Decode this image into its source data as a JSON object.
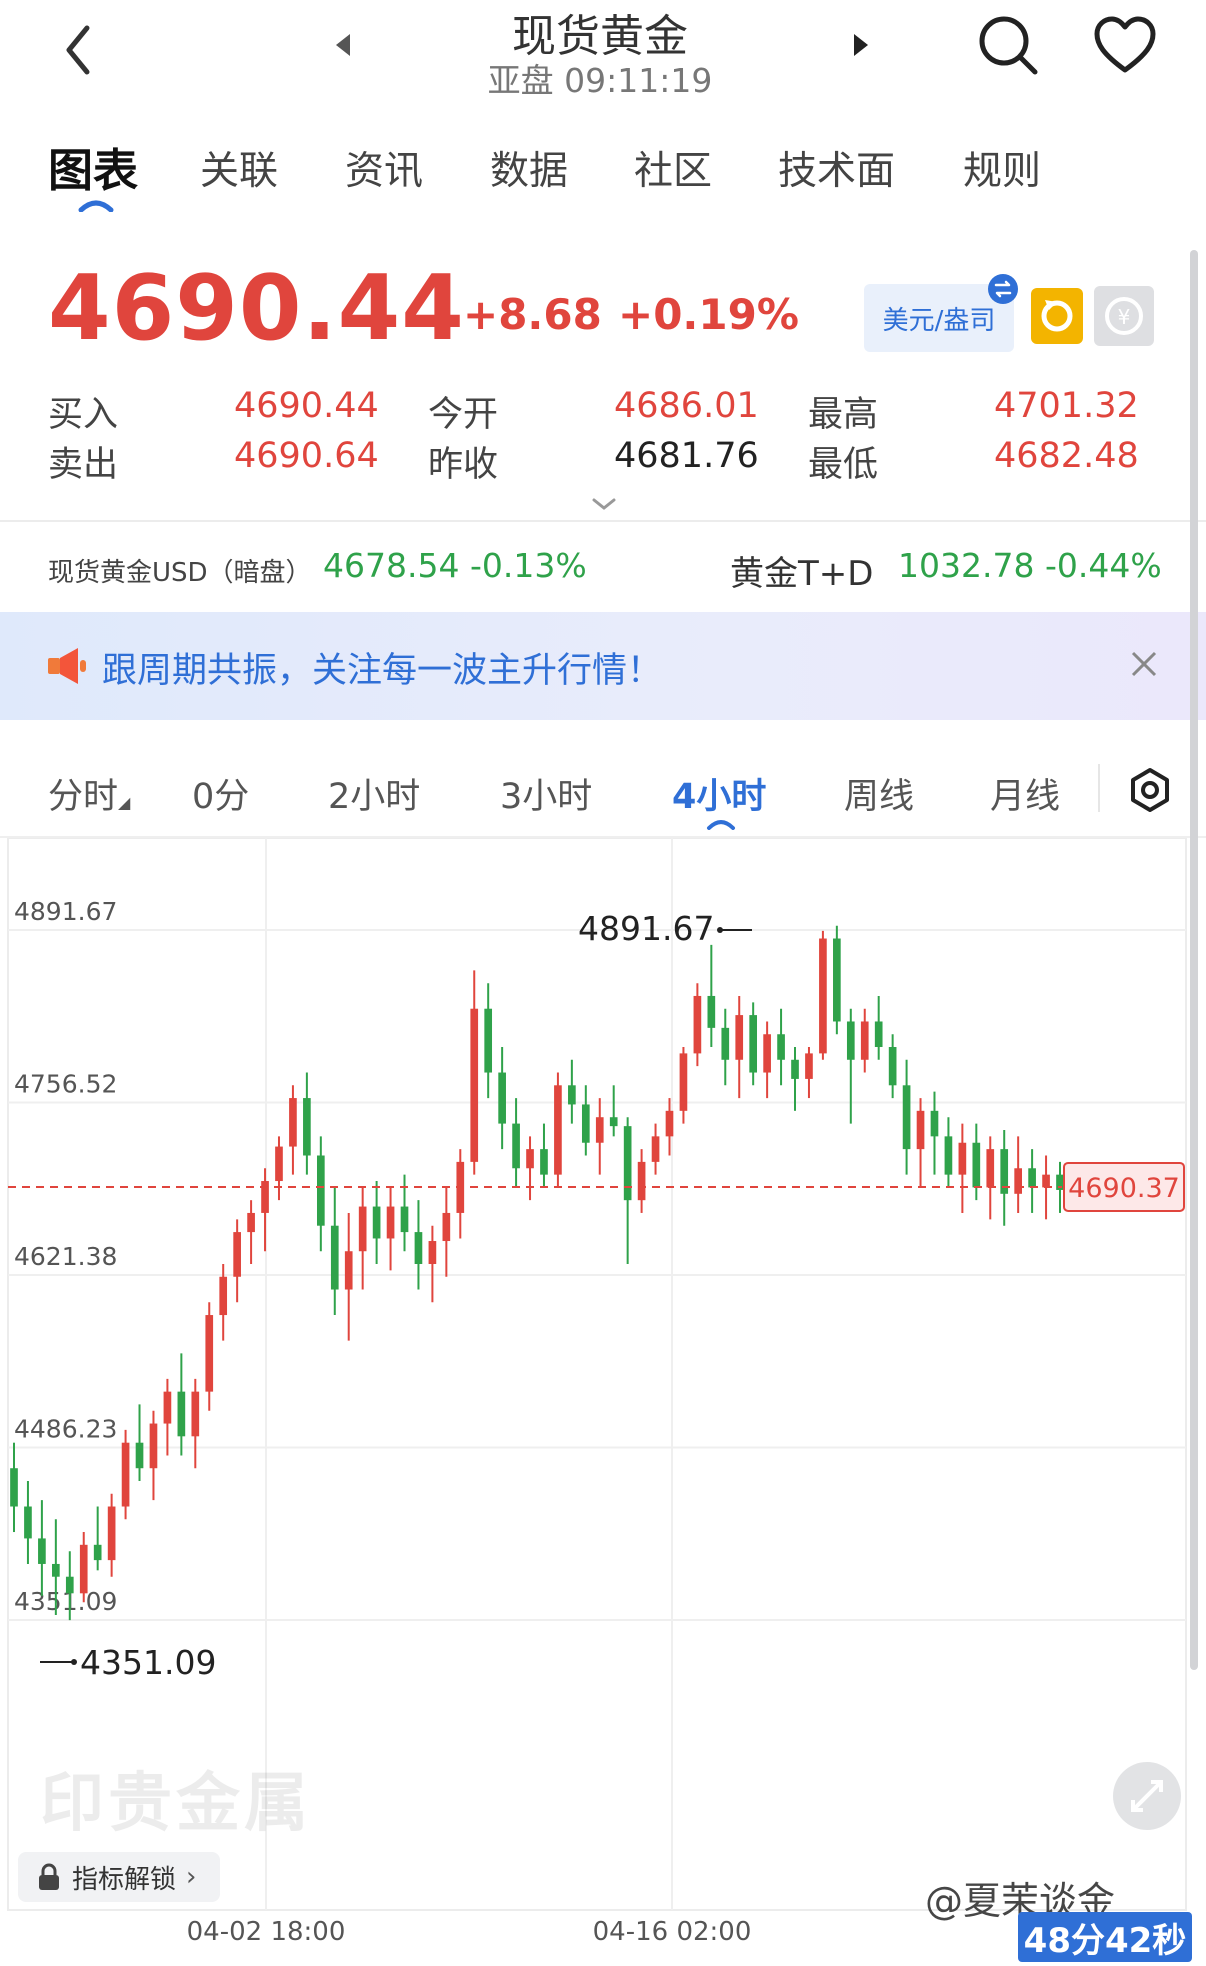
{
  "header": {
    "title": "现货黄金",
    "subtitle": "亚盘 09:11:19"
  },
  "tabs": [
    {
      "label": "图表",
      "active": true
    },
    {
      "label": "关联"
    },
    {
      "label": "资讯"
    },
    {
      "label": "数据"
    },
    {
      "label": "社区"
    },
    {
      "label": "技术面"
    },
    {
      "label": "规则"
    }
  ],
  "quote": {
    "price": "4690.44",
    "change": "+8.68",
    "change_pct": "+0.19%",
    "unit_label": "美元/盎司",
    "bid_label": "买入",
    "bid": "4690.44",
    "ask_label": "卖出",
    "ask": "4690.64",
    "open_label": "今开",
    "open": "4686.01",
    "prev_close_label": "昨收",
    "prev_close": "4681.76",
    "high_label": "最高",
    "high": "4701.32",
    "low_label": "最低",
    "low": "4682.48"
  },
  "related": {
    "left_name": "现货黄金USD（暗盘）",
    "left_value": "4678.54  -0.13%",
    "right_name": "黄金T+D",
    "right_value": "1032.78  -0.44%"
  },
  "banner": {
    "text": "跟周期共振，关注每一波主升行情！"
  },
  "periods": [
    {
      "label": "分时"
    },
    {
      "label": "0分"
    },
    {
      "label": "2小时"
    },
    {
      "label": "3小时"
    },
    {
      "label": "4小时",
      "active": true
    },
    {
      "label": "周线"
    },
    {
      "label": "月线"
    }
  ],
  "chart_data": {
    "type": "candlestick",
    "y_ticks": [
      "4891.67",
      "4756.52",
      "4621.38",
      "4486.23",
      "4351.09"
    ],
    "x_ticks": [
      "04-02 18:00",
      "04-16 02:00"
    ],
    "max_label": "4891.67",
    "min_label": "4351.09",
    "current_price_label": "4690.37",
    "ylim": [
      4351.09,
      4891.67
    ],
    "up_color": "#e0453d",
    "down_color": "#2fa24a",
    "ohlc": [
      [
        4470,
        4490,
        4420,
        4440
      ],
      [
        4440,
        4460,
        4395,
        4415
      ],
      [
        4415,
        4445,
        4370,
        4395
      ],
      [
        4395,
        4430,
        4355,
        4385
      ],
      [
        4385,
        4405,
        4351,
        4372
      ],
      [
        4372,
        4420,
        4365,
        4410
      ],
      [
        4410,
        4440,
        4390,
        4398
      ],
      [
        4398,
        4450,
        4385,
        4440
      ],
      [
        4440,
        4500,
        4430,
        4490
      ],
      [
        4490,
        4520,
        4460,
        4470
      ],
      [
        4470,
        4515,
        4445,
        4505
      ],
      [
        4505,
        4540,
        4480,
        4530
      ],
      [
        4530,
        4560,
        4480,
        4495
      ],
      [
        4495,
        4540,
        4470,
        4530
      ],
      [
        4530,
        4600,
        4515,
        4590
      ],
      [
        4590,
        4630,
        4570,
        4620
      ],
      [
        4620,
        4665,
        4600,
        4655
      ],
      [
        4655,
        4680,
        4630,
        4670
      ],
      [
        4670,
        4705,
        4640,
        4695
      ],
      [
        4695,
        4730,
        4680,
        4722
      ],
      [
        4722,
        4770,
        4700,
        4760
      ],
      [
        4760,
        4780,
        4700,
        4715
      ],
      [
        4715,
        4730,
        4640,
        4660
      ],
      [
        4660,
        4690,
        4590,
        4610
      ],
      [
        4610,
        4670,
        4570,
        4640
      ],
      [
        4640,
        4690,
        4610,
        4675
      ],
      [
        4675,
        4695,
        4630,
        4650
      ],
      [
        4650,
        4690,
        4625,
        4675
      ],
      [
        4675,
        4700,
        4640,
        4655
      ],
      [
        4655,
        4680,
        4610,
        4630
      ],
      [
        4630,
        4660,
        4600,
        4648
      ],
      [
        4648,
        4690,
        4620,
        4670
      ],
      [
        4670,
        4720,
        4650,
        4710
      ],
      [
        4710,
        4860,
        4700,
        4830
      ],
      [
        4830,
        4850,
        4760,
        4780
      ],
      [
        4780,
        4800,
        4720,
        4740
      ],
      [
        4740,
        4760,
        4690,
        4705
      ],
      [
        4705,
        4730,
        4680,
        4720
      ],
      [
        4720,
        4740,
        4690,
        4700
      ],
      [
        4700,
        4780,
        4690,
        4770
      ],
      [
        4770,
        4790,
        4740,
        4755
      ],
      [
        4755,
        4770,
        4715,
        4725
      ],
      [
        4725,
        4760,
        4700,
        4745
      ],
      [
        4745,
        4770,
        4730,
        4738
      ],
      [
        4738,
        4745,
        4630,
        4680
      ],
      [
        4680,
        4720,
        4670,
        4710
      ],
      [
        4710,
        4740,
        4700,
        4730
      ],
      [
        4730,
        4760,
        4715,
        4750
      ],
      [
        4750,
        4800,
        4740,
        4795
      ],
      [
        4795,
        4850,
        4785,
        4840
      ],
      [
        4840,
        4880,
        4800,
        4815
      ],
      [
        4815,
        4830,
        4770,
        4790
      ],
      [
        4790,
        4840,
        4760,
        4825
      ],
      [
        4825,
        4835,
        4770,
        4780
      ],
      [
        4780,
        4820,
        4760,
        4810
      ],
      [
        4810,
        4830,
        4770,
        4790
      ],
      [
        4790,
        4800,
        4750,
        4775
      ],
      [
        4775,
        4800,
        4760,
        4795
      ],
      [
        4795,
        4891,
        4790,
        4885
      ],
      [
        4885,
        4895,
        4810,
        4820
      ],
      [
        4820,
        4830,
        4740,
        4790
      ],
      [
        4790,
        4830,
        4780,
        4820
      ],
      [
        4820,
        4840,
        4790,
        4800
      ],
      [
        4800,
        4810,
        4760,
        4770
      ],
      [
        4770,
        4790,
        4700,
        4720
      ],
      [
        4720,
        4760,
        4690,
        4750
      ],
      [
        4750,
        4765,
        4700,
        4730
      ],
      [
        4730,
        4745,
        4690,
        4700
      ],
      [
        4700,
        4740,
        4670,
        4725
      ],
      [
        4725,
        4740,
        4680,
        4690
      ],
      [
        4690,
        4730,
        4665,
        4720
      ],
      [
        4720,
        4735,
        4660,
        4685
      ],
      [
        4685,
        4730,
        4670,
        4705
      ],
      [
        4705,
        4720,
        4670,
        4690
      ],
      [
        4690,
        4715,
        4665,
        4700
      ],
      [
        4700,
        4710,
        4670,
        4688
      ]
    ]
  }
}
